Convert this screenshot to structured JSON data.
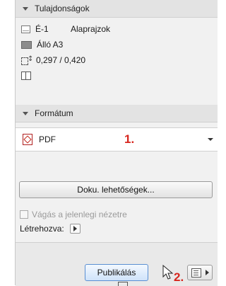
{
  "properties": {
    "header": "Tulajdonságok",
    "layout_id": "É-1",
    "layout_name": "Alaprajzok",
    "paper_size": "Álló A3",
    "dimensions": "0,297 / 0,420"
  },
  "format": {
    "header": "Formátum",
    "selected": "PDF",
    "marker": "1."
  },
  "doc_options_label": "Doku. lehetőségek...",
  "crop_label": "Vágás a jelenlegi nézetre",
  "created_label": "Létrehozva:",
  "publish_label": "Publikálás",
  "marker2": "2."
}
